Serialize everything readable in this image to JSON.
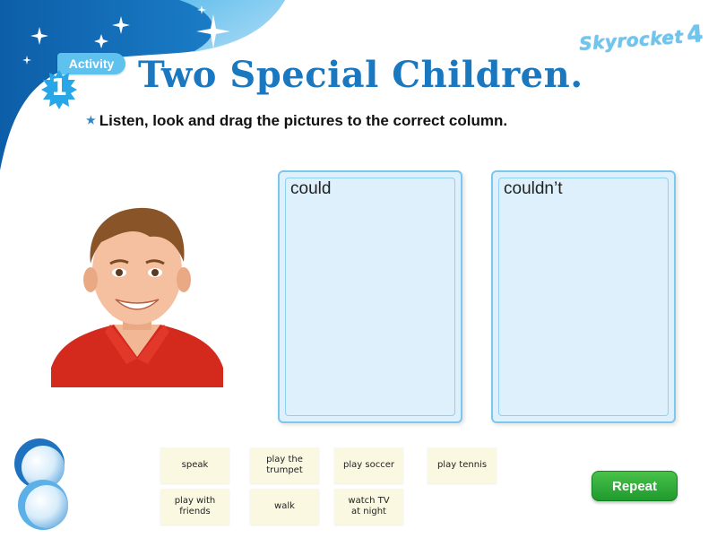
{
  "branding": {
    "logo_text": "Skyrocket",
    "logo_number": "4"
  },
  "activity": {
    "tag": "Activity",
    "number": "1"
  },
  "title": "Two Special Children.",
  "instruction": "Listen, look and drag the pictures to the correct column.",
  "columns": [
    {
      "label": "could"
    },
    {
      "label": "couldn’t"
    }
  ],
  "image": {
    "description": "boy-photo"
  },
  "cards": [
    {
      "label": "speak"
    },
    {
      "label": "play the\ntrumpet"
    },
    {
      "label": "play soccer"
    },
    {
      "label": "play tennis"
    },
    {
      "label": "play with\nfriends"
    },
    {
      "label": "walk"
    },
    {
      "label": "watch TV\nat night"
    }
  ],
  "buttons": {
    "repeat": "Repeat"
  },
  "colors": {
    "title": "#1a78c0",
    "banner": "#1b6fb6",
    "column_fill": "#ddf0fb",
    "card_fill": "#fbf8e1",
    "repeat_green": "#2aa93a"
  }
}
